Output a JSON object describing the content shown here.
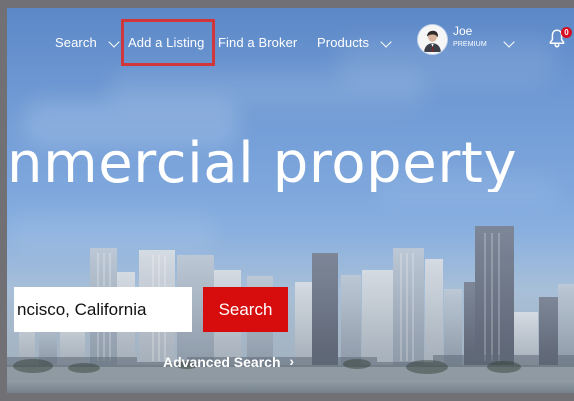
{
  "header": {
    "nav": {
      "search_label": "Search",
      "add_listing_label": "Add a Listing",
      "find_broker_label": "Find a Broker",
      "products_label": "Products"
    },
    "user": {
      "name": "Joe",
      "tier": "PREMIUM"
    },
    "notifications": {
      "count": "0"
    }
  },
  "hero": {
    "headline": "nmercial property"
  },
  "search": {
    "location_value": "ncisco, California",
    "button_label": "Search",
    "advanced_label": "Advanced Search"
  },
  "icons": {
    "chevron": "chevron-down-icon",
    "bell": "bell-icon",
    "avatar": "user-avatar",
    "advanced_chevron": "chevron-right-icon"
  },
  "colors": {
    "accent_red": "#d70d0d",
    "highlight_red": "#d1363b",
    "text_white": "#ffffff"
  }
}
